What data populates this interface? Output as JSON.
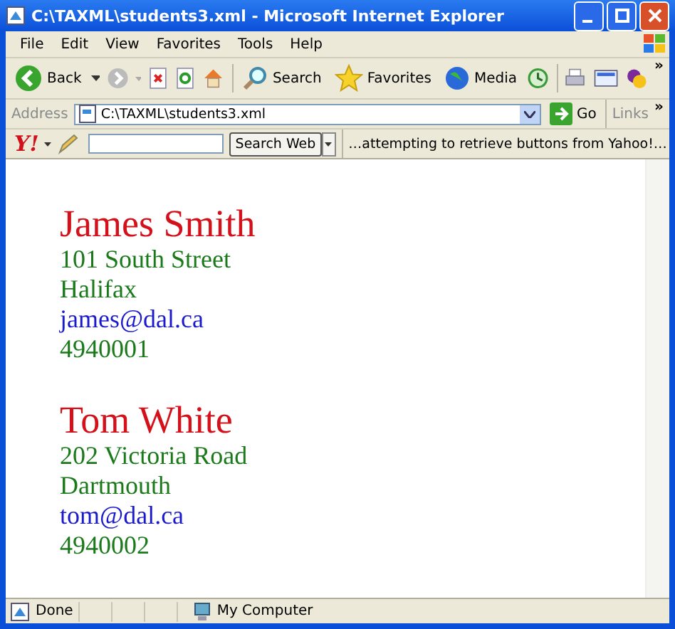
{
  "window": {
    "title": "C:\\TAXML\\students3.xml - Microsoft Internet Explorer"
  },
  "menu": [
    "File",
    "Edit",
    "View",
    "Favorites",
    "Tools",
    "Help"
  ],
  "toolbar": {
    "back": "Back",
    "search": "Search",
    "favorites": "Favorites",
    "media": "Media",
    "more": "»"
  },
  "address_bar": {
    "label": "Address",
    "value": "C:\\TAXML\\students3.xml",
    "go": "Go",
    "links": "Links",
    "more": "»"
  },
  "yahoo_bar": {
    "logo": "Y!",
    "search_button": "Search Web",
    "status": "…attempting to retrieve buttons from Yahoo!…"
  },
  "students": [
    {
      "name": "James Smith",
      "lines": [
        {
          "kind": "text",
          "text": "101 South Street"
        },
        {
          "kind": "text",
          "text": "Halifax"
        },
        {
          "kind": "email",
          "text": "james@dal.ca"
        },
        {
          "kind": "text",
          "text": "4940001"
        }
      ]
    },
    {
      "name": "Tom White",
      "lines": [
        {
          "kind": "text",
          "text": "202 Victoria Road"
        },
        {
          "kind": "text",
          "text": "Dartmouth"
        },
        {
          "kind": "email",
          "text": "tom@dal.ca"
        },
        {
          "kind": "text",
          "text": "4940002"
        }
      ]
    }
  ],
  "status_bar": {
    "text": "Done",
    "zone": "My Computer"
  }
}
